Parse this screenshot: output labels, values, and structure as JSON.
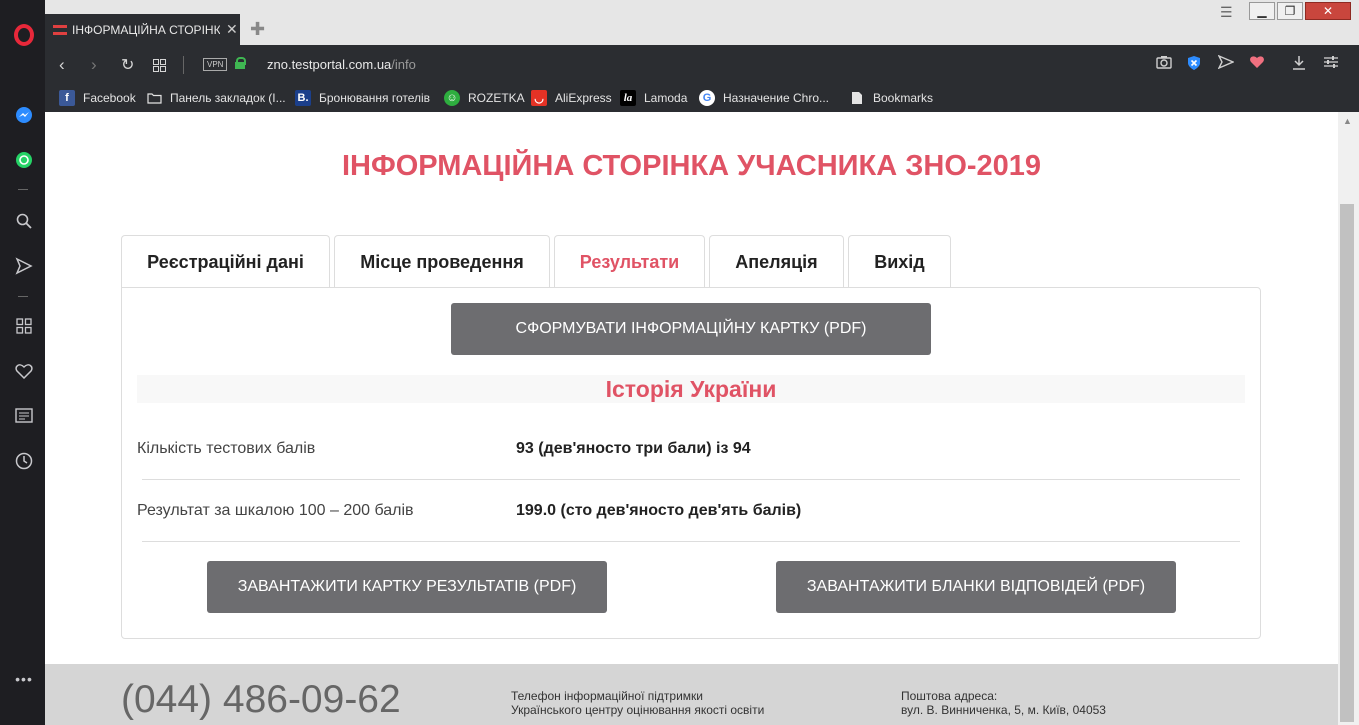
{
  "browser": {
    "tab_title": "ІНФОРМАЦІЙНА СТОРІНКА",
    "url_host": "zno.testportal.com.ua",
    "url_path": "/info",
    "vpn_label": "VPN",
    "bookmarks": [
      {
        "label": "Facebook",
        "icon": "facebook-icon"
      },
      {
        "label": "Панель закладок (І...",
        "icon": "folder-icon"
      },
      {
        "label": "Бронювання готелів",
        "icon": "booking-icon"
      },
      {
        "label": "ROZETKA",
        "icon": "rozetka-icon"
      },
      {
        "label": "AliExpress",
        "icon": "aliexpress-icon"
      },
      {
        "label": "Lamoda",
        "icon": "lamoda-icon"
      },
      {
        "label": "Назначение Chro...",
        "icon": "google-icon"
      },
      {
        "label": "Bookmarks",
        "icon": "file-icon"
      }
    ]
  },
  "page": {
    "title": "ІНФОРМАЦІЙНА СТОРІНКА УЧАСНИКА ЗНО-2019",
    "tabs": [
      {
        "label": "Реєстраційні дані"
      },
      {
        "label": "Місце проведення"
      },
      {
        "label": "Результати"
      },
      {
        "label": "Апеляція"
      },
      {
        "label": "Вихід"
      }
    ],
    "generate_button": "СФОРМУВАТИ ІНФОРМАЦІЙНУ КАРТКУ (PDF)",
    "subject": "Історія України",
    "rows": [
      {
        "label": "Кількість тестових балів",
        "value": "93 (дев'яносто три бали) із 94"
      },
      {
        "label": "Результат за шкалою 100 – 200 балів",
        "value": "199.0 (сто дев'яносто дев'ять балів)"
      }
    ],
    "download_card_button": "ЗАВАНТАЖИТИ КАРТКУ РЕЗУЛЬТАТІВ (PDF)",
    "download_answers_button": "ЗАВАНТАЖИТИ БЛАНКИ ВІДПОВІДЕЙ (PDF)"
  },
  "footer": {
    "phone": "(044) 486-09-62",
    "support_line1": "Телефон інформаційної підтримки",
    "support_line2": "Українського центру оцінювання якості освіти",
    "address_line1": "Поштова адреса:",
    "address_line2": "вул. В. Винниченка, 5, м. Київ, 04053"
  },
  "colors": {
    "accent": "#e05365",
    "button": "#6d6d70"
  }
}
